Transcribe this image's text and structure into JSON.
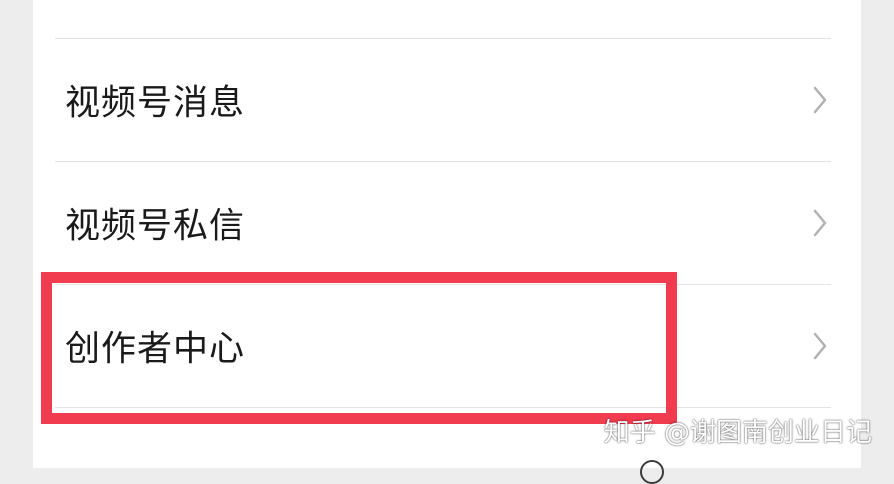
{
  "menu": {
    "items": [
      {
        "label": "视频号消息"
      },
      {
        "label": "视频号私信"
      },
      {
        "label": "创作者中心"
      }
    ]
  },
  "watermark": {
    "text": "知乎 @谢图南创业日记"
  },
  "colors": {
    "background": "#ededed",
    "panel": "#ffffff",
    "divider": "#e3e3e3",
    "highlight": "#f13b4f",
    "chevron": "#b2b2b2",
    "text": "#1a1a1a"
  },
  "icons": {
    "row_arrow": "chevron-right-icon"
  }
}
